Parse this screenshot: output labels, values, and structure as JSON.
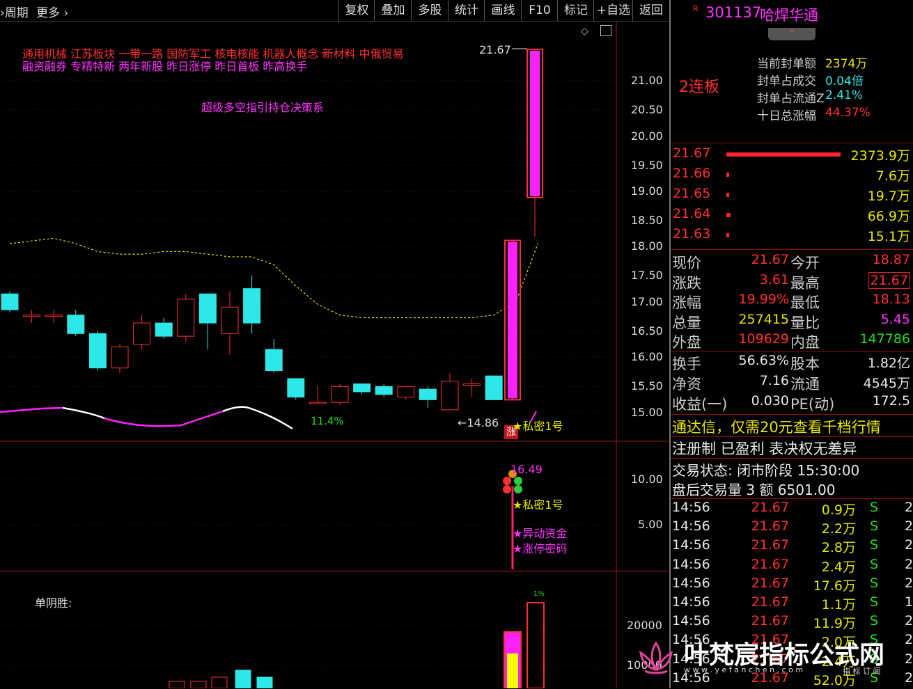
{
  "toolbar": {
    "period_label": "周期",
    "more_label": "更多",
    "buttons": [
      "复权",
      "叠加",
      "多股",
      "统计",
      "画线",
      "F10",
      "标记",
      "+自选",
      "返回"
    ]
  },
  "concepts": {
    "line1": "通用机械  江苏板块  一带一路 国防军工 核电核能 机器人概念 新材料 中俄贸易",
    "line2": "融资融券 专精特新 两年新股 昨日涨停 昨日首板 昨高换手"
  },
  "indicator_title": "超级多空指引持仓决策系",
  "main_annotations": {
    "high_label": "21.67",
    "low_label": "14.86",
    "pct_label": "11.4%",
    "limit_badge": "涨",
    "star1": "★私密1号"
  },
  "sub1_annotations": {
    "value": "16.49",
    "star1": "★私密1号",
    "star2": "★异动资金",
    "star3": "★涨停密码"
  },
  "sub2_annotations": {
    "title": "单阴胜:",
    "top_label": "1%"
  },
  "axis": {
    "main_ticks": [
      "21.00",
      "20.50",
      "20.00",
      "19.50",
      "19.00",
      "18.50",
      "18.00",
      "17.50",
      "17.00",
      "16.50",
      "16.00",
      "15.50",
      "15.00"
    ],
    "sub1_ticks": [
      "10.00",
      "5.00"
    ],
    "sub2_ticks": [
      "20000",
      "10000"
    ]
  },
  "chart_data": {
    "type": "candlestick",
    "ylim": [
      14.7,
      21.8
    ],
    "candles": [
      {
        "o": 17.05,
        "c": 16.75,
        "h": 17.1,
        "l": 16.7
      },
      {
        "o": 16.65,
        "c": 16.65,
        "h": 16.75,
        "l": 16.5
      },
      {
        "o": 16.65,
        "c": 16.65,
        "h": 16.75,
        "l": 16.5
      },
      {
        "o": 16.65,
        "c": 16.3,
        "h": 16.75,
        "l": 16.25
      },
      {
        "o": 16.3,
        "c": 15.65,
        "h": 16.35,
        "l": 15.6
      },
      {
        "o": 15.65,
        "c": 16.05,
        "h": 16.1,
        "l": 15.55
      },
      {
        "o": 16.1,
        "c": 16.5,
        "h": 16.65,
        "l": 16.0
      },
      {
        "o": 16.5,
        "c": 16.25,
        "h": 16.6,
        "l": 16.2
      },
      {
        "o": 16.25,
        "c": 16.95,
        "h": 17.05,
        "l": 16.15
      },
      {
        "o": 17.05,
        "c": 16.5,
        "h": 17.05,
        "l": 16.0
      },
      {
        "o": 16.3,
        "c": 16.8,
        "h": 17.1,
        "l": 15.9
      },
      {
        "o": 17.15,
        "c": 16.5,
        "h": 17.4,
        "l": 16.3
      },
      {
        "o": 16.0,
        "c": 15.6,
        "h": 16.2,
        "l": 15.55
      },
      {
        "o": 15.45,
        "c": 15.1,
        "h": 15.45,
        "l": 15.05
      },
      {
        "o": 15.0,
        "c": 15.0,
        "h": 15.3,
        "l": 15.0
      },
      {
        "o": 15.0,
        "c": 15.3,
        "h": 15.35,
        "l": 14.95
      },
      {
        "o": 15.35,
        "c": 15.2,
        "h": 15.35,
        "l": 15.15
      },
      {
        "o": 15.3,
        "c": 15.15,
        "h": 15.35,
        "l": 15.1
      },
      {
        "o": 15.1,
        "c": 15.3,
        "h": 15.3,
        "l": 15.05
      },
      {
        "o": 15.25,
        "c": 15.05,
        "h": 15.3,
        "l": 14.9
      },
      {
        "o": 14.86,
        "c": 15.4,
        "h": 15.55,
        "l": 14.85
      },
      {
        "o": 15.35,
        "c": 15.35,
        "h": 15.45,
        "l": 15.1
      },
      {
        "o": 15.5,
        "c": 15.05,
        "h": 15.5,
        "l": 15.05
      },
      {
        "o": 15.05,
        "c": 18.06,
        "h": 18.06,
        "l": 15.05
      },
      {
        "o": 18.87,
        "c": 21.67,
        "h": 21.67,
        "l": 18.13
      }
    ],
    "ma_dashed": [
      18.0,
      18.05,
      18.1,
      18.0,
      17.85,
      17.8,
      17.8,
      17.85,
      17.85,
      17.8,
      17.75,
      17.75,
      17.6,
      17.2,
      16.85,
      16.65,
      16.6,
      16.6,
      16.6,
      16.6,
      16.6,
      16.6,
      16.65,
      16.9,
      18.0
    ]
  },
  "panel": {
    "stock_code": "301137",
    "stock_name": "哈焊华通",
    "r_badge": "R",
    "board_label": "2连板",
    "seal_items": [
      {
        "label": "当前封单额",
        "value": "2374万"
      },
      {
        "label": "封单占成交",
        "value": "0.04倍"
      },
      {
        "label": "封单占流通Z",
        "value": "2.41%"
      },
      {
        "label": "十日总涨幅",
        "value": "44.37%"
      }
    ],
    "bids": [
      {
        "price": "21.67",
        "vol": "2373.9万"
      },
      {
        "price": "21.66",
        "vol": "7.6万"
      },
      {
        "price": "21.65",
        "vol": "19.7万"
      },
      {
        "price": "21.64",
        "vol": "66.9万"
      },
      {
        "price": "21.63",
        "vol": "15.1万"
      }
    ],
    "quote": [
      {
        "l1": "现价",
        "v1": "21.67",
        "l2": "今开",
        "v2": "18.87"
      },
      {
        "l1": "涨跌",
        "v1": "3.61",
        "l2": "最高",
        "v2": "21.67"
      },
      {
        "l1": "涨幅",
        "v1": "19.99%",
        "l2": "最低",
        "v2": "18.13"
      },
      {
        "l1": "总量",
        "v1": "257415",
        "l2": "量比",
        "v2": "5.45"
      },
      {
        "l1": "外盘",
        "v1": "109629",
        "l2": "内盘",
        "v2": "147786"
      }
    ],
    "fund": [
      {
        "l1": "换手",
        "v1": "56.63%",
        "l2": "股本",
        "v2": "1.82亿"
      },
      {
        "l1": "净资",
        "v1": "7.16",
        "l2": "流通",
        "v2": "4545万"
      },
      {
        "l1": "收益(一)",
        "v1": "0.030",
        "l2": "PE(动)",
        "v2": "172.5"
      }
    ],
    "promo": "通达信，仅需20元查看千档行情",
    "reg": "注册制 已盈利 表决权无差异",
    "trade_state": "交易状态: 闭市阶段 15:30:00",
    "after_hours": "盘后交易量 3 额 6501.00",
    "ticks": [
      {
        "time": "14:56",
        "price": "21.67",
        "vol": "0.9万",
        "side": "S",
        "n": "2"
      },
      {
        "time": "14:56",
        "price": "21.67",
        "vol": "2.2万",
        "side": "S",
        "n": "2"
      },
      {
        "time": "14:56",
        "price": "21.67",
        "vol": "2.8万",
        "side": "S",
        "n": "2"
      },
      {
        "time": "14:56",
        "price": "21.67",
        "vol": "2.4万",
        "side": "S",
        "n": "2"
      },
      {
        "time": "14:56",
        "price": "21.67",
        "vol": "17.6万",
        "side": "S",
        "n": "2"
      },
      {
        "time": "14:56",
        "price": "21.67",
        "vol": "1.1万",
        "side": "S",
        "n": "1"
      },
      {
        "time": "14:56",
        "price": "21.67",
        "vol": "11.9万",
        "side": "S",
        "n": "2"
      },
      {
        "time": "14:56",
        "price": "21.67",
        "vol": "2.0万",
        "side": "S",
        "n": "2"
      },
      {
        "time": "14:56",
        "price": "21.67",
        "vol": "2.4万",
        "side": "S",
        "n": "2"
      },
      {
        "time": "14:56",
        "price": "21.67",
        "vol": "52.0万",
        "side": "S",
        "n": "2"
      }
    ]
  },
  "watermark": {
    "title": "叶梵宸指标公式网",
    "url": "w w w . y e f a n c h e n . c o m",
    "sub": "指 标 订 阅"
  }
}
